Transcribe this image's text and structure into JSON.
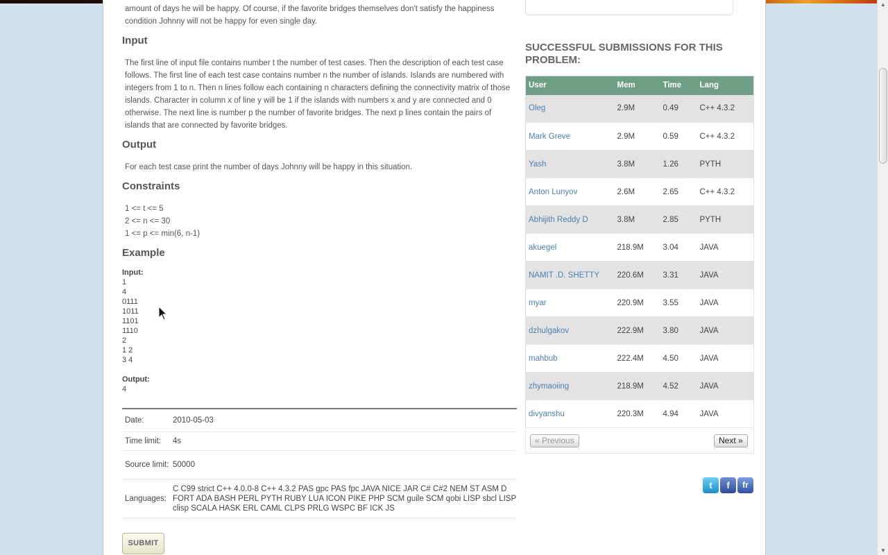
{
  "problem": {
    "intro_fragment": "amount of days he will be happy. Of course, if the favorite bridges themselves don't satisfy the happiness condition Johnny will not be happy for even single day.",
    "input_heading": "Input",
    "input_text": "The first line of input file contains number t the number of test cases. Then the description of each test case follows. The first line of each test case contains number n the number of islands. Islands are numbered with integers from 1 to n. Then n lines follow each containing n characters defining the connectivity matrix of those islands. Character in column x of line y will be 1 if the islands with numbers x and y are connected and 0 otherwise. The next line is number p the number of favorite bridges. The next p lines contain the pairs of islands that are connected by favorite bridges.",
    "output_heading": "Output",
    "output_text": "For each test case print the number of days Johnny will be happy in this situation.",
    "constraints_heading": "Constraints",
    "constraints": [
      "1 <= t <= 5",
      "2 <= n <= 30",
      "1 <= p <= min(6, n-1)"
    ],
    "example_heading": "Example",
    "example_input_label": "Input:",
    "example_input": [
      "1",
      "4",
      "0111",
      "1011",
      "1101",
      "1110",
      "2",
      "1 2",
      "3 4"
    ],
    "example_output_label": "Output:",
    "example_output": [
      "4"
    ]
  },
  "info": {
    "date_label": "Date:",
    "date": "2010-05-03",
    "time_limit_label": "Time limit:",
    "time_limit": "4s",
    "source_limit_label": "Source limit:",
    "source_limit": "50000",
    "languages_label": "Languages:",
    "languages": "C C99 strict C++ 4.0.0-8 C++ 4.3.2 PAS gpc PAS fpc JAVA NICE JAR C# C#2 NEM ST ASM D FORT ADA BASH PERL PYTH RUBY LUA ICON PIKE PHP SCM guile SCM qobi LISP sbcl LISP clisp SCALA HASK ERL CAML CLPS PRLG WSPC BF ICK JS"
  },
  "submit_label": "SUBMIT",
  "submissions": {
    "heading": "SUCCESSFUL SUBMISSIONS FOR THIS PROBLEM:",
    "columns": [
      "User",
      "Mem",
      "Time",
      "Lang"
    ],
    "rows": [
      [
        "Oleg",
        "2.9M",
        "0.49",
        "C++ 4.3.2"
      ],
      [
        "Mark Greve",
        "2.9M",
        "0.59",
        "C++ 4.3.2"
      ],
      [
        "Yash",
        "3.8M",
        "1.26",
        "PYTH"
      ],
      [
        "Anton Lunyov",
        "2.6M",
        "2.65",
        "C++ 4.3.2"
      ],
      [
        "Abhijith Reddy D",
        "3.8M",
        "2.85",
        "PYTH"
      ],
      [
        "akuegel",
        "218.9M",
        "3.04",
        "JAVA"
      ],
      [
        "NAMIT .D. SHETTY",
        "220.6M",
        "3.31",
        "JAVA"
      ],
      [
        "myar",
        "220.9M",
        "3.55",
        "JAVA"
      ],
      [
        "dzhulgakov",
        "222.9M",
        "3.80",
        "JAVA"
      ],
      [
        "mahbub",
        "222.4M",
        "4.50",
        "JAVA"
      ],
      [
        "zhymaoiing",
        "218.9M",
        "4.52",
        "JAVA"
      ],
      [
        "divyanshu",
        "220.3M",
        "4.94",
        "JAVA"
      ]
    ],
    "prev_label": "« Previous",
    "next_label": "Next »"
  },
  "social": {
    "twitter": "t",
    "facebook": "f",
    "friendfeed": "fr"
  },
  "colors": {
    "header_bg": "#6f9e86",
    "link": "#4a7fb5",
    "page_bg": "#cfe1ef"
  }
}
